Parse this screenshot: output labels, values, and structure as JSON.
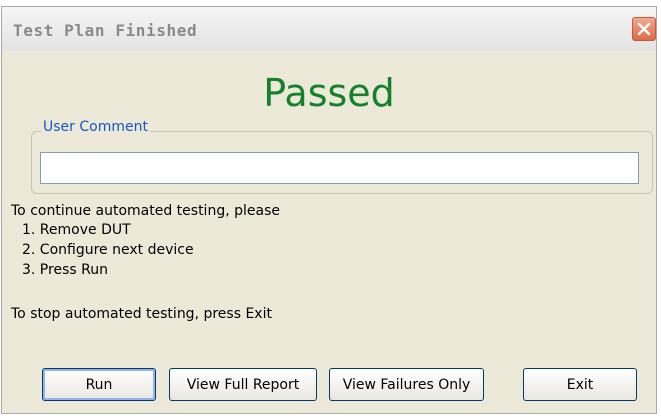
{
  "window": {
    "title": "Test Plan Finished"
  },
  "result": {
    "text": "Passed",
    "color": "#13822b"
  },
  "comment": {
    "label": "User Comment",
    "value": "",
    "placeholder": ""
  },
  "instructions": {
    "intro": "To continue automated testing, please",
    "steps": [
      "1. Remove DUT",
      "2. Configure next device",
      "3. Press Run"
    ],
    "stop": "To stop automated testing, press Exit"
  },
  "buttons": {
    "run": "Run",
    "view_full_report": "View Full Report",
    "view_failures_only": "View Failures Only",
    "exit": "Exit"
  },
  "icons": {
    "close": "close-icon"
  }
}
